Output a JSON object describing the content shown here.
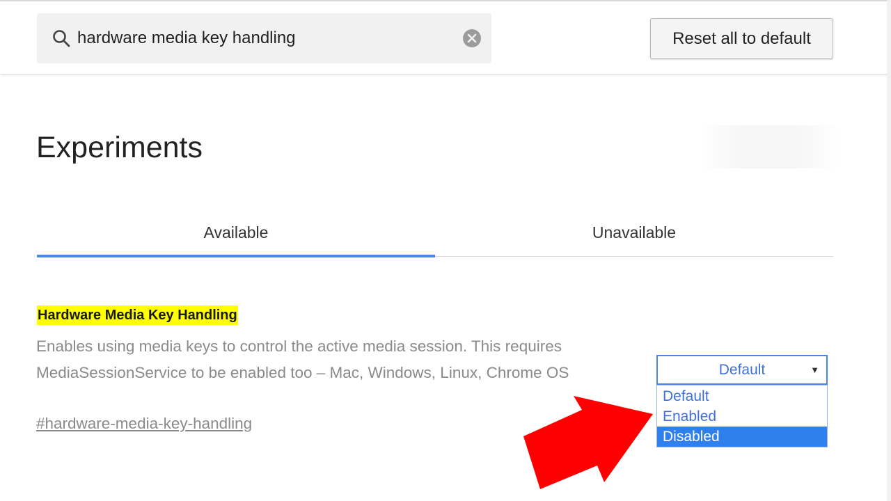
{
  "search": {
    "value": "hardware media key handling",
    "search_icon": "search-icon",
    "clear_icon": "clear-icon"
  },
  "header": {
    "reset_label": "Reset all to default"
  },
  "main": {
    "title": "Experiments",
    "tabs": [
      {
        "label": "Available",
        "active": true
      },
      {
        "label": "Unavailable",
        "active": false
      }
    ]
  },
  "experiment": {
    "title": "Hardware Media Key Handling",
    "description": "Enables using media keys to control the active media session. This requires MediaSessionService to be enabled too – Mac, Windows, Linux, Chrome OS",
    "link": "#hardware-media-key-handling",
    "select": {
      "value": "Default",
      "options": [
        "Default",
        "Enabled",
        "Disabled"
      ],
      "highlighted": "Disabled"
    }
  },
  "colors": {
    "accent": "#4a86e8",
    "highlight": "#ffff00",
    "option_selected": "#2f80ed",
    "arrow": "#ff0000"
  }
}
